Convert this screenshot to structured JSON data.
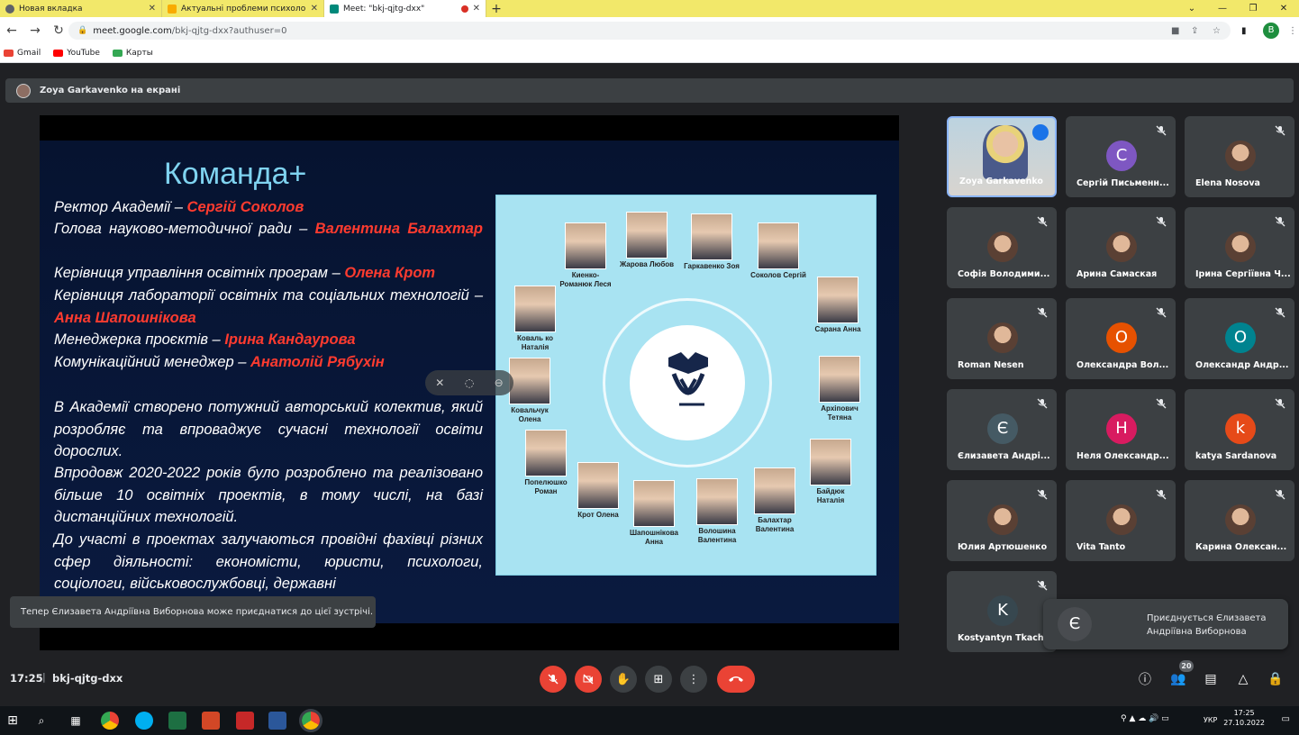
{
  "tabs": [
    {
      "title": "Новая вкладка",
      "color": "#5f6368"
    },
    {
      "title": "Актуальні проблеми психології",
      "color": "#f9ab00"
    },
    {
      "title": "Meet: \"bkj-qjtg-dxx\"",
      "color": "#00897b"
    }
  ],
  "omnibox": {
    "host": "meet.google.com",
    "path": "/bkj-qjtg-dxx?authuser=0"
  },
  "profile_initial": "B",
  "bookmarks": [
    {
      "label": "Gmail",
      "color": "#ea4335"
    },
    {
      "label": "YouTube",
      "color": "#ff0000"
    },
    {
      "label": "Карты",
      "color": "#34a853"
    }
  ],
  "present_banner": "Zoya Garkavenko на екрані",
  "slide": {
    "title": "Команда+",
    "lines": [
      {
        "pre": "Ректор Академії – ",
        "name": "Сергій Соколов"
      },
      {
        "pre": "Голова науково-методичної ради – ",
        "name": "Валентина Балахтар"
      },
      {
        "pre": "Керівниця управління освітніх програм – ",
        "name": "Олена Крот"
      },
      {
        "pre": "Керівниця лабораторії освітніх та соціальних технологій – ",
        "name": "Анна Шапошнікова"
      },
      {
        "pre": "Менеджерка проєктів – ",
        "name": "Ірина Кандаурова"
      },
      {
        "pre": "Комунікаційний менеджер – ",
        "name": "Анатолій Рябухін"
      }
    ],
    "para1": "В Академії створено потужний авторський колектив, який розробляє та впроваджує сучасні технології освіти дорослих.",
    "para2": "Впродовж 2020-2022 років було розроблено та реалізовано більше 10 освітніх проектів, в тому числі, на базі дистанційних технологій.",
    "para3": "До участі в проектах залучаються провідні фахівці різних сфер діяльності: економісти, юристи, психологи, соціологи, військовослужбовці, державні",
    "members": [
      {
        "name": "Киенко-Романюк Леся"
      },
      {
        "name": "Жарова Любов"
      },
      {
        "name": "Гаркавенко Зоя"
      },
      {
        "name": "Соколов Сергій"
      },
      {
        "name": "Коваль ко Наталія"
      },
      {
        "name": "Сарана Анна"
      },
      {
        "name": "Ковальчук Олена"
      },
      {
        "name": "Архіпович Тетяна"
      },
      {
        "name": "Попелюшко Роман"
      },
      {
        "name": "Крот Олена"
      },
      {
        "name": "Шапошнікова Анна"
      },
      {
        "name": "Волошина Валентина"
      },
      {
        "name": "Балахтар Валентина"
      },
      {
        "name": "Байдюк Наталія"
      }
    ]
  },
  "participants": [
    {
      "name": "Zoya Garkavenko",
      "initial": "",
      "color": "",
      "photo": true,
      "speaking": true
    },
    {
      "name": "Сергій Письменн...",
      "initial": "С",
      "color": "#7e57c2",
      "photo": false
    },
    {
      "name": "Elena Nosova",
      "initial": "",
      "color": "",
      "photo": true
    },
    {
      "name": "Софія Володими...",
      "initial": "",
      "color": "",
      "photo": true
    },
    {
      "name": "Арина Самаская",
      "initial": "",
      "color": "",
      "photo": true
    },
    {
      "name": "Ірина Сергіївна Ч...",
      "initial": "",
      "color": "",
      "photo": true
    },
    {
      "name": "Roman Nesen",
      "initial": "",
      "color": "",
      "photo": true
    },
    {
      "name": "Олександра Вол...",
      "initial": "О",
      "color": "#e65100",
      "photo": false
    },
    {
      "name": "Олександр Андр...",
      "initial": "О",
      "color": "#00838f",
      "photo": false
    },
    {
      "name": "Єлизавета Андрі...",
      "initial": "Є",
      "color": "#455a64",
      "photo": false
    },
    {
      "name": "Неля Олександр...",
      "initial": "Н",
      "color": "#d81b60",
      "photo": false
    },
    {
      "name": "katya Sardanova",
      "initial": "k",
      "color": "#e64a19",
      "photo": false
    },
    {
      "name": "Юлия Артюшенко",
      "initial": "",
      "color": "",
      "photo": true
    },
    {
      "name": "Vita Tanto",
      "initial": "",
      "color": "",
      "photo": true
    },
    {
      "name": "Карина Олексан...",
      "initial": "",
      "color": "",
      "photo": true
    },
    {
      "name": "Kostyantyn Tkach...",
      "initial": "K",
      "color": "#37474f",
      "photo": false
    }
  ],
  "toast": "Тепер Єлизавета Андріївна Виборнова може приєднатися до цієї зустрічі.",
  "join": {
    "initial": "Є",
    "text": "Приєднується Єлизавета Андріївна Виборнова"
  },
  "bottom": {
    "time": "17:25",
    "code": "bkj-qjtg-dxx",
    "participant_count": "20"
  },
  "taskbar": {
    "time": "17:25",
    "date": "27.10.2022",
    "lang": "УКР"
  }
}
